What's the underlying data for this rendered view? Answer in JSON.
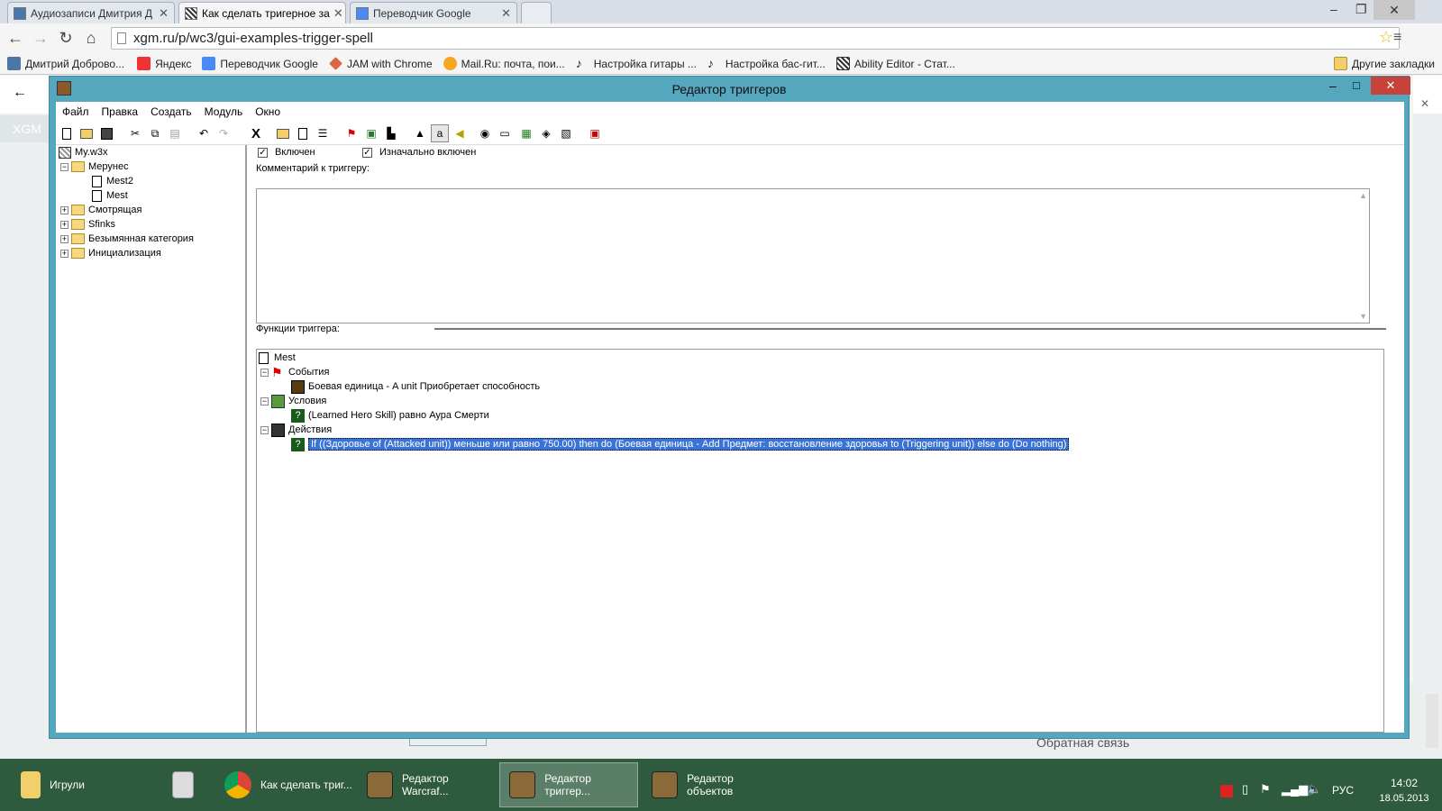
{
  "browser": {
    "tabs": [
      {
        "title": "Аудиозаписи Дмитрия Д",
        "active": false
      },
      {
        "title": "Как сделать тригерное за",
        "active": true
      },
      {
        "title": "Переводчик Google",
        "active": false
      }
    ],
    "url": "xgm.ru/p/wc3/gui-examples-trigger-spell",
    "bookmarks": [
      {
        "label": "Дмитрий Доброво...",
        "icon": "vk-icon"
      },
      {
        "label": "Яндекс",
        "icon": "yandex-icon"
      },
      {
        "label": "Переводчик Google",
        "icon": "translate-icon"
      },
      {
        "label": "JAM with Chrome",
        "icon": "jam-icon"
      },
      {
        "label": "Mail.Ru: почта, пои...",
        "icon": "mailru-icon"
      },
      {
        "label": "Настройка гитары ...",
        "icon": "guitar-icon"
      },
      {
        "label": "Настройка бас-гит...",
        "icon": "bass-icon"
      },
      {
        "label": "Ability Editor - Стат...",
        "icon": "ability-icon"
      }
    ],
    "other_bookmarks": "Другие закладки",
    "page_left_text": "XGM",
    "page_footer_text": "Обратная связь"
  },
  "editor": {
    "title": "Редактор триггеров",
    "menu": [
      "Файл",
      "Правка",
      "Создать",
      "Модуль",
      "Окно"
    ],
    "tree": {
      "root": "My.w3x",
      "nodes": [
        {
          "label": "Мерунес",
          "type": "folder",
          "level": 1,
          "expander": "−"
        },
        {
          "label": "Mest2",
          "type": "trigger",
          "level": 2
        },
        {
          "label": "Mest",
          "type": "trigger",
          "level": 2
        },
        {
          "label": "Смотрящая",
          "type": "folder",
          "level": 1,
          "expander": "+"
        },
        {
          "label": "Sfinks",
          "type": "folder",
          "level": 1,
          "expander": "+"
        },
        {
          "label": "Безымянная категория",
          "type": "folder",
          "level": 1,
          "expander": "+"
        },
        {
          "label": "Инициализация",
          "type": "folder",
          "level": 1,
          "expander": "+"
        }
      ]
    },
    "enabled_label": "Включен",
    "initially_enabled_label": "Изначально включен",
    "comment_label": "Комментарий к триггеру:",
    "functions_label": "Функции триггера:",
    "functions": {
      "trigger_name": "Mest",
      "events_label": "События",
      "event": "Боевая единица - A unit Приобретает способность",
      "conditions_label": "Условия",
      "condition": "(Learned Hero Skill) равно Аура Смерти",
      "actions_label": "Действия",
      "action": "If ((Здоровье of (Attacked unit)) меньше или равно 750.00) then do (Боевая единица - Add Предмет: восстановление здоровья  to (Triggering unit)) else do (Do nothing)"
    }
  },
  "taskbar": {
    "items": [
      {
        "label": "Игрули",
        "icon": "folder-icon",
        "active": false
      },
      {
        "label": "",
        "icon": "calculator-icon",
        "active": false
      },
      {
        "label": "Как сделать триг...",
        "icon": "chrome-icon",
        "active": false
      },
      {
        "label": "Редактор Warcraf...",
        "icon": "warcraft-editor-icon",
        "active": false
      },
      {
        "label": "Редактор триггер...",
        "icon": "warcraft-editor-icon",
        "active": true
      },
      {
        "label": "Редактор объектов",
        "icon": "warcraft-editor-icon",
        "active": false
      }
    ],
    "lang": "РУС",
    "time": "14:02",
    "date": "18.05.2013"
  }
}
